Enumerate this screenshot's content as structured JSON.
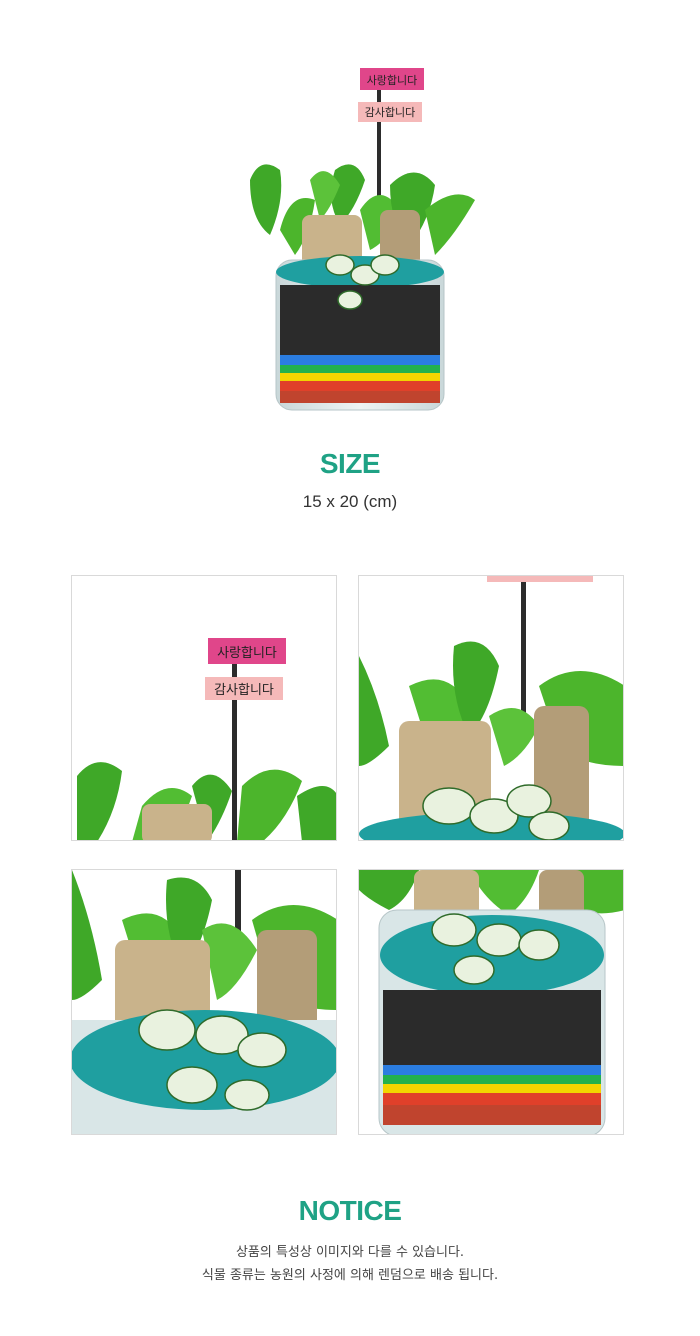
{
  "product": {
    "sign_top": "사랑합니다",
    "sign_bottom": "감사합니다"
  },
  "size": {
    "title": "SIZE",
    "value": "15 x 20 (cm)"
  },
  "notice": {
    "title": "NOTICE",
    "lines": [
      "상품의 특성상 이미지와 다를 수 있습니다.",
      "식물 종류는 농원의 사정에 의해 렌덤으로 배송 됩니다."
    ]
  },
  "colors": {
    "accent": "#1fa285",
    "sign_pink": "#e0468a",
    "sign_light": "#f5b9b9",
    "leaf": "#3fa828",
    "bead": "#1f9fa0"
  }
}
